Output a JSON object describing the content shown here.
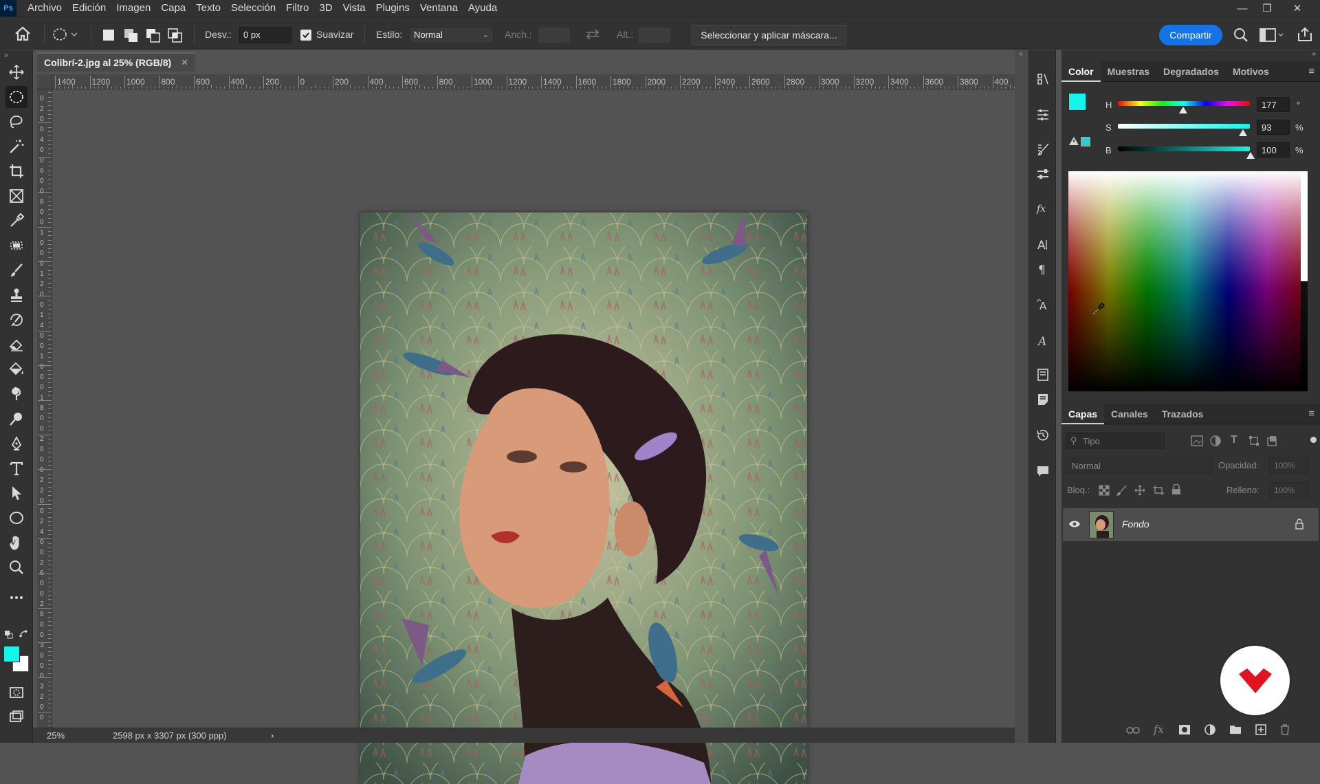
{
  "app": {
    "logo_text": "Ps"
  },
  "menu": [
    "Archivo",
    "Edición",
    "Imagen",
    "Capa",
    "Texto",
    "Selección",
    "Filtro",
    "3D",
    "Vista",
    "Plugins",
    "Ventana",
    "Ayuda"
  ],
  "options": {
    "feather_label": "Desv.:",
    "feather_value": "0 px",
    "antialias_label": "Suavizar",
    "antialias_checked": true,
    "style_label": "Estilo:",
    "style_value": "Normal",
    "width_label": "Anch.:",
    "height_label": "Alt.:",
    "mask_button": "Seleccionar y aplicar máscara...",
    "share_button": "Compartir"
  },
  "document": {
    "tab_title": "Colibrí-2.jpg al 25% (RGB/8)",
    "zoom": "25%",
    "info": "2598 px x 3307 px (300 ppp)"
  },
  "ruler_labels": [
    "1400",
    "1200",
    "1000",
    "800",
    "600",
    "400",
    "200",
    "0",
    "200",
    "400",
    "600",
    "800",
    "1000",
    "1200",
    "1400",
    "1600",
    "1800",
    "2000",
    "2200",
    "2400",
    "2600",
    "2800",
    "3000",
    "3200",
    "3400",
    "3600",
    "3800",
    "400"
  ],
  "ruler_v_labels": [
    "0",
    "2",
    "0",
    "0",
    "4",
    "0",
    "0",
    "6",
    "0",
    "0",
    "8",
    "0",
    "0",
    "1",
    "0",
    "0",
    "0",
    "1",
    "2",
    "0",
    "0",
    "1",
    "4",
    "0",
    "0",
    "1",
    "6",
    "0",
    "0",
    "1",
    "8",
    "0",
    "0",
    "2",
    "0",
    "0",
    "0",
    "2",
    "2",
    "0",
    "0",
    "2",
    "4",
    "0",
    "0",
    "2",
    "6",
    "0",
    "0",
    "2",
    "8",
    "0",
    "0",
    "3",
    "0",
    "0",
    "0",
    "3",
    "2",
    "0",
    "0"
  ],
  "color_panel": {
    "tabs": [
      "Color",
      "Muestras",
      "Degradados",
      "Motivos"
    ],
    "h_label": "H",
    "h_value": "177",
    "h_unit": "°",
    "s_label": "S",
    "s_value": "93",
    "s_unit": "%",
    "b_label": "B",
    "b_value": "100",
    "b_unit": "%",
    "fg_color": "#12f5ea",
    "bg_color": "#ffffff",
    "websafe_color": "#33cccc"
  },
  "layers_panel": {
    "tabs": [
      "Capas",
      "Canales",
      "Trazados"
    ],
    "search_placeholder": "Tipo",
    "blend_mode": "Normal",
    "opacity_label": "Opacidad:",
    "opacity_value": "100%",
    "lock_label": "Bloq.:",
    "fill_label": "Relleno:",
    "fill_value": "100%",
    "layers": [
      {
        "name": "Fondo",
        "visible": true,
        "locked": true
      }
    ]
  },
  "toolbox": {
    "fg_color": "#12f5ea",
    "bg_color": "#ffffff"
  },
  "colors": {
    "accent": "#1473e6",
    "brand_logo": "#e0131e"
  }
}
